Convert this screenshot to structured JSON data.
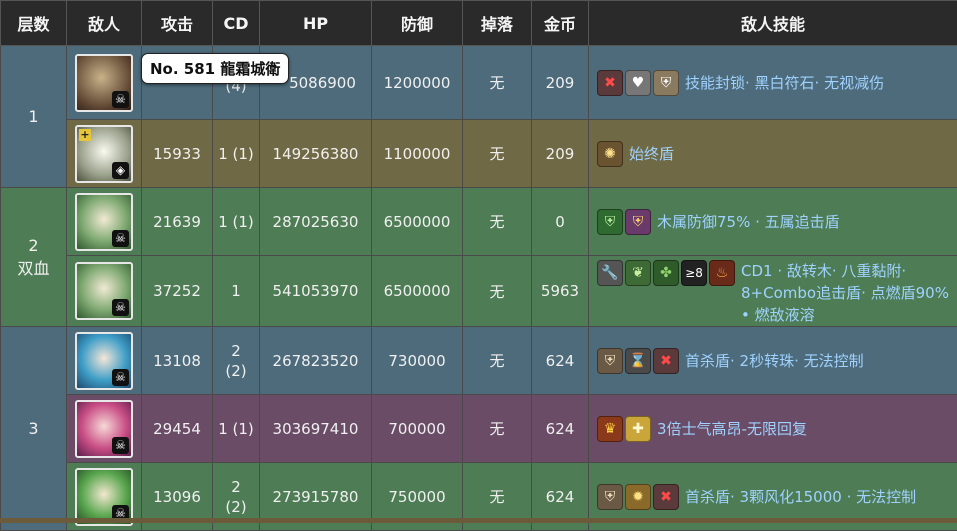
{
  "headers": {
    "floor": "层数",
    "enemy": "敌人",
    "attack": "攻击",
    "cd": "CD",
    "hp": "HP",
    "defense": "防御",
    "drop": "掉落",
    "coins": "金币",
    "skills": "敌人技能"
  },
  "floors": [
    {
      "label": "1"
    },
    {
      "label": "2",
      "sublabel": "双血"
    },
    {
      "label": "3"
    }
  ],
  "rows": [
    {
      "attack": "",
      "cd": "(4)",
      "hp": "5086900",
      "defense": "1200000",
      "drop": "无",
      "coins": "209",
      "skill_text": "技能封锁· 黑白符石· 无视减伤",
      "avatar_badge": "☠"
    },
    {
      "attack": "15933",
      "cd": "1 (1)",
      "hp": "149256380",
      "defense": "1100000",
      "drop": "无",
      "coins": "209",
      "skill_text": "始终盾",
      "avatar_badge": "◈"
    },
    {
      "attack": "21639",
      "cd": "1 (1)",
      "hp": "287025630",
      "defense": "6500000",
      "drop": "无",
      "coins": "0",
      "skill_text": "木属防御75% · 五属追击盾",
      "avatar_badge": "☠"
    },
    {
      "attack": "37252",
      "cd": "1",
      "hp": "541053970",
      "defense": "6500000",
      "drop": "无",
      "coins": "5963",
      "skill_text": "CD1 · 敌转木· 八重黏附· 8+Combo追击盾· 点燃盾90% • 燃敌液溶",
      "avatar_badge": "☠"
    },
    {
      "attack": "13108",
      "cd": "2\n(2)",
      "hp": "267823520",
      "defense": "730000",
      "drop": "无",
      "coins": "624",
      "skill_text": "首杀盾· 2秒转珠· 无法控制",
      "avatar_badge": "☠"
    },
    {
      "attack": "29454",
      "cd": "1 (1)",
      "hp": "303697410",
      "defense": "700000",
      "drop": "无",
      "coins": "624",
      "skill_text": "3倍士气高昂-无限回复",
      "avatar_badge": "☠"
    },
    {
      "attack": "13096",
      "cd": "2\n(2)",
      "hp": "273915780",
      "defense": "750000",
      "drop": "无",
      "coins": "624",
      "skill_text": "首杀盾· 3颗风化15000 · 无法控制",
      "avatar_badge": "☠"
    }
  ],
  "tooltip": "No. 581 龍霜城衛",
  "icons": {
    "r1": [
      "skill-seal-icon",
      "black-white-heart-icon",
      "shield-break-icon"
    ],
    "r2": [
      "spiral-shield-icon"
    ],
    "r3": [
      "green-shield-icon",
      "multi-shield-icon"
    ],
    "r4": [
      "wrench-icon",
      "leaf-convert-icon",
      "clover-icon",
      "combo-8-icon",
      "fire-icon"
    ],
    "r5": [
      "shield-icon",
      "hourglass-icon",
      "stat-lock-icon"
    ],
    "r6": [
      "flame-crown-icon",
      "cross-heal-icon"
    ],
    "r7": [
      "shield-icon",
      "burst-icon",
      "stat-lock-icon"
    ]
  }
}
